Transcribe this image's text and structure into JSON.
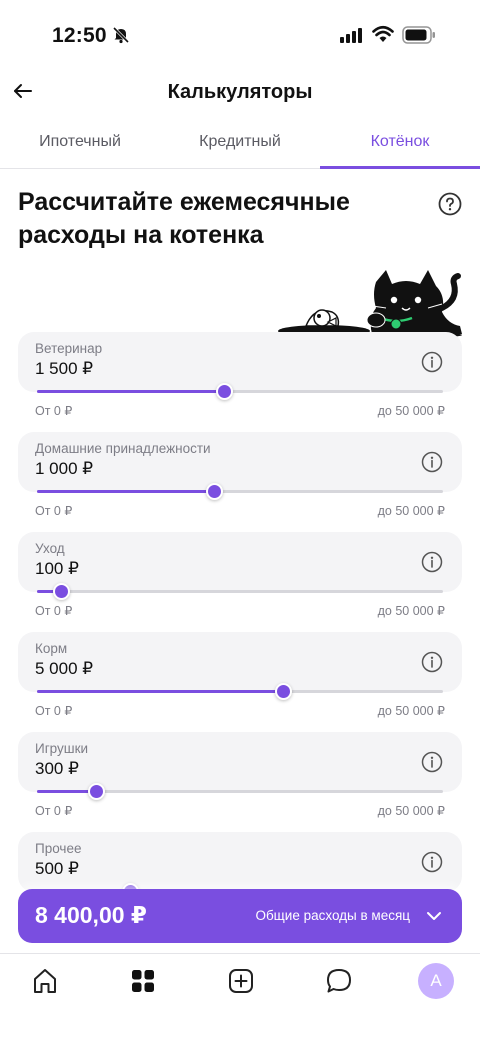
{
  "status_bar": {
    "time": "12:50"
  },
  "header": {
    "title": "Калькуляторы"
  },
  "tabs": [
    {
      "label": "Ипотечный"
    },
    {
      "label": "Кредитный"
    },
    {
      "label": "Котёнок",
      "active": true
    }
  ],
  "hero": {
    "title": "Рассчитайте ежемесячные расходы на котенка"
  },
  "range": {
    "min": "От 0 ₽",
    "max": "до 50 000 ₽"
  },
  "expenses": [
    {
      "label": "Ветеринар",
      "value": "1 500 ₽",
      "slider_fraction": 0.46
    },
    {
      "label": "Домашние принадлежности",
      "value": "1 000 ₽",
      "slider_fraction": 0.435
    },
    {
      "label": "Уход",
      "value": "100 ₽",
      "slider_fraction": 0.06
    },
    {
      "label": "Корм",
      "value": "5 000 ₽",
      "slider_fraction": 0.605
    },
    {
      "label": "Игрушки",
      "value": "300 ₽",
      "slider_fraction": 0.145
    },
    {
      "label": "Прочее",
      "value": "500 ₽",
      "slider_fraction": 0.23
    }
  ],
  "total": {
    "amount": "8 400,00 ₽",
    "label": "Общие расходы в месяц"
  },
  "bottom_nav": {
    "items": [
      "home-icon",
      "grid-icon",
      "add-icon",
      "chat-icon"
    ],
    "avatar_letter": "A"
  },
  "colors": {
    "accent": "#7a4ee0",
    "card_bg": "#f4f4f6",
    "avatar_bg": "#c7b0ff"
  }
}
